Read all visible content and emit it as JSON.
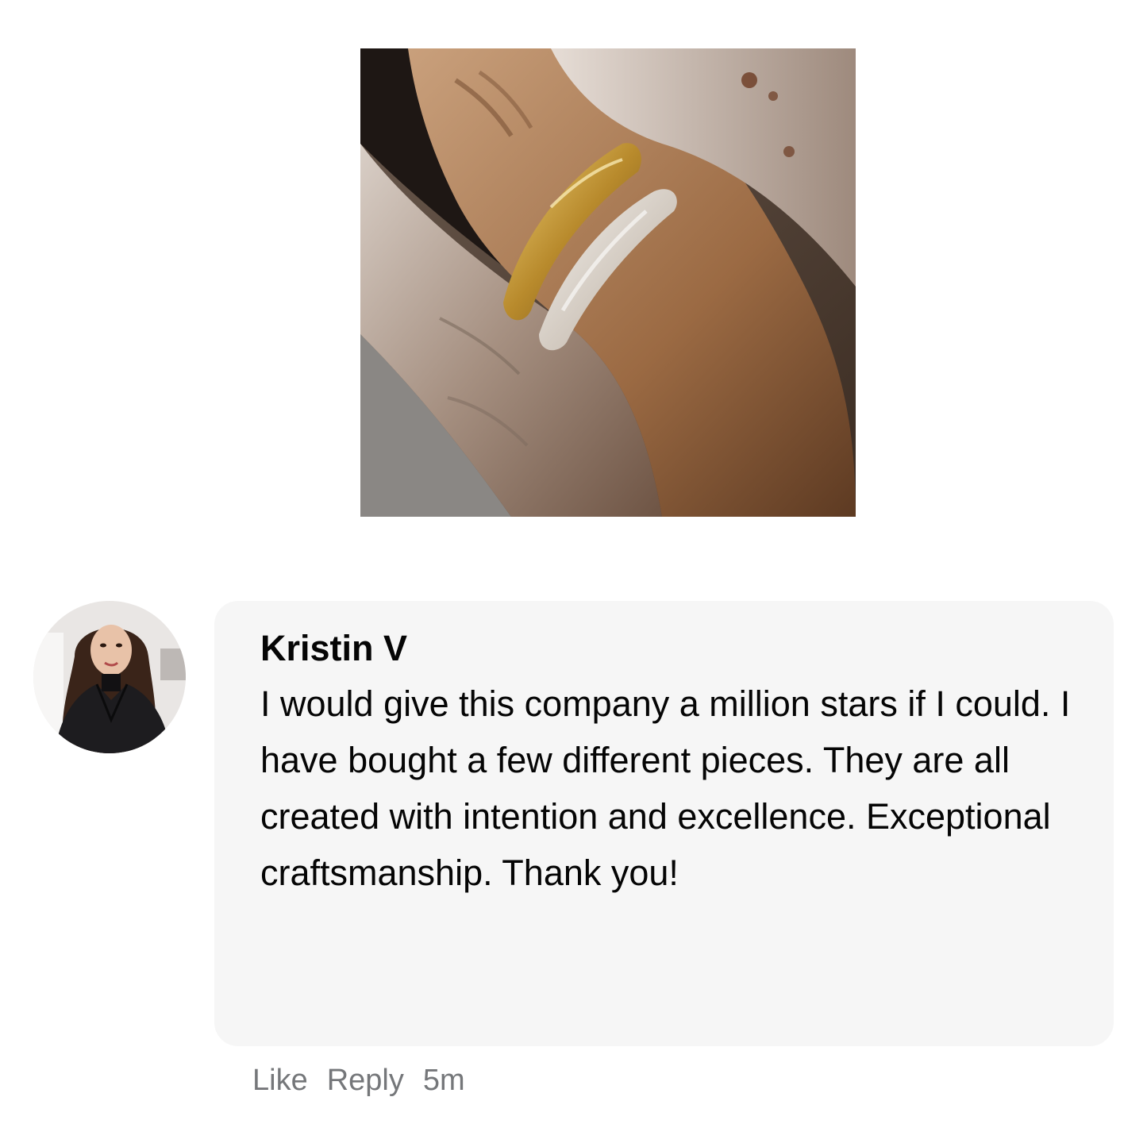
{
  "post": {
    "image": {
      "subject": "hand-with-rings-photo"
    }
  },
  "comment": {
    "author": "Kristin V",
    "text": "I would give this company a million stars if I could. I have bought a few different pieces. They are all created with intention and excellence. Exceptional craftsmanship. Thank you!",
    "avatar": {
      "subject": "profile-photo"
    }
  },
  "actions": {
    "like_label": "Like",
    "reply_label": "Reply",
    "timestamp": "5m"
  },
  "colors": {
    "bubble_bg": "#f6f6f6",
    "text": "#050505",
    "meta_text": "#75777a"
  }
}
